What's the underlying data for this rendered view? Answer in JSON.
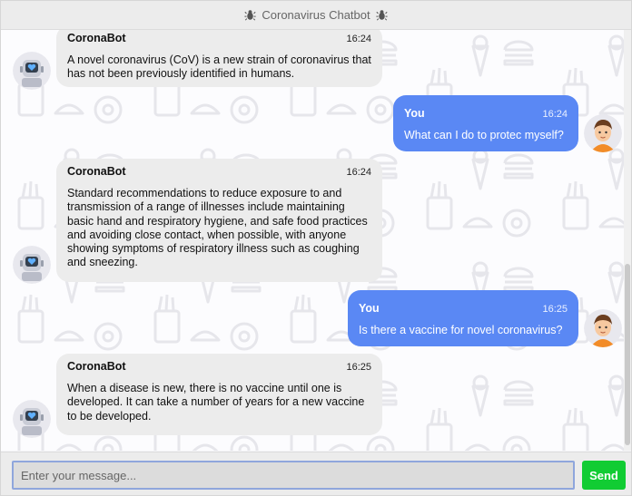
{
  "header": {
    "title": "Coronavirus Chatbot",
    "icon": "bug-icon"
  },
  "messages": [
    {
      "sender": "CoronaBot",
      "time": "16:24",
      "role": "bot",
      "text": "A novel coronavirus (CoV) is a new strain of coronavirus that has not been previously identified in humans."
    },
    {
      "sender": "You",
      "time": "16:24",
      "role": "user",
      "text": "What can I do to protec myself?"
    },
    {
      "sender": "CoronaBot",
      "time": "16:24",
      "role": "bot",
      "text": "Standard recommendations to reduce exposure to and transmission of a range of illnesses include maintaining basic hand and respiratory hygiene, and safe food practices and avoiding close contact, when possible, with anyone showing symptoms of respiratory illness such as coughing and sneezing."
    },
    {
      "sender": "You",
      "time": "16:25",
      "role": "user",
      "text": "Is there a vaccine for novel coronavirus?"
    },
    {
      "sender": "CoronaBot",
      "time": "16:25",
      "role": "bot",
      "text": "When a disease is new, there is no vaccine until one is developed. It can take a number of years for a new vaccine to be developed."
    }
  ],
  "composer": {
    "placeholder": "Enter your message...",
    "value": "",
    "send_label": "Send"
  },
  "colors": {
    "user_bubble": "#5a88f4",
    "bot_bubble": "#ececec",
    "send": "#11cc33"
  }
}
